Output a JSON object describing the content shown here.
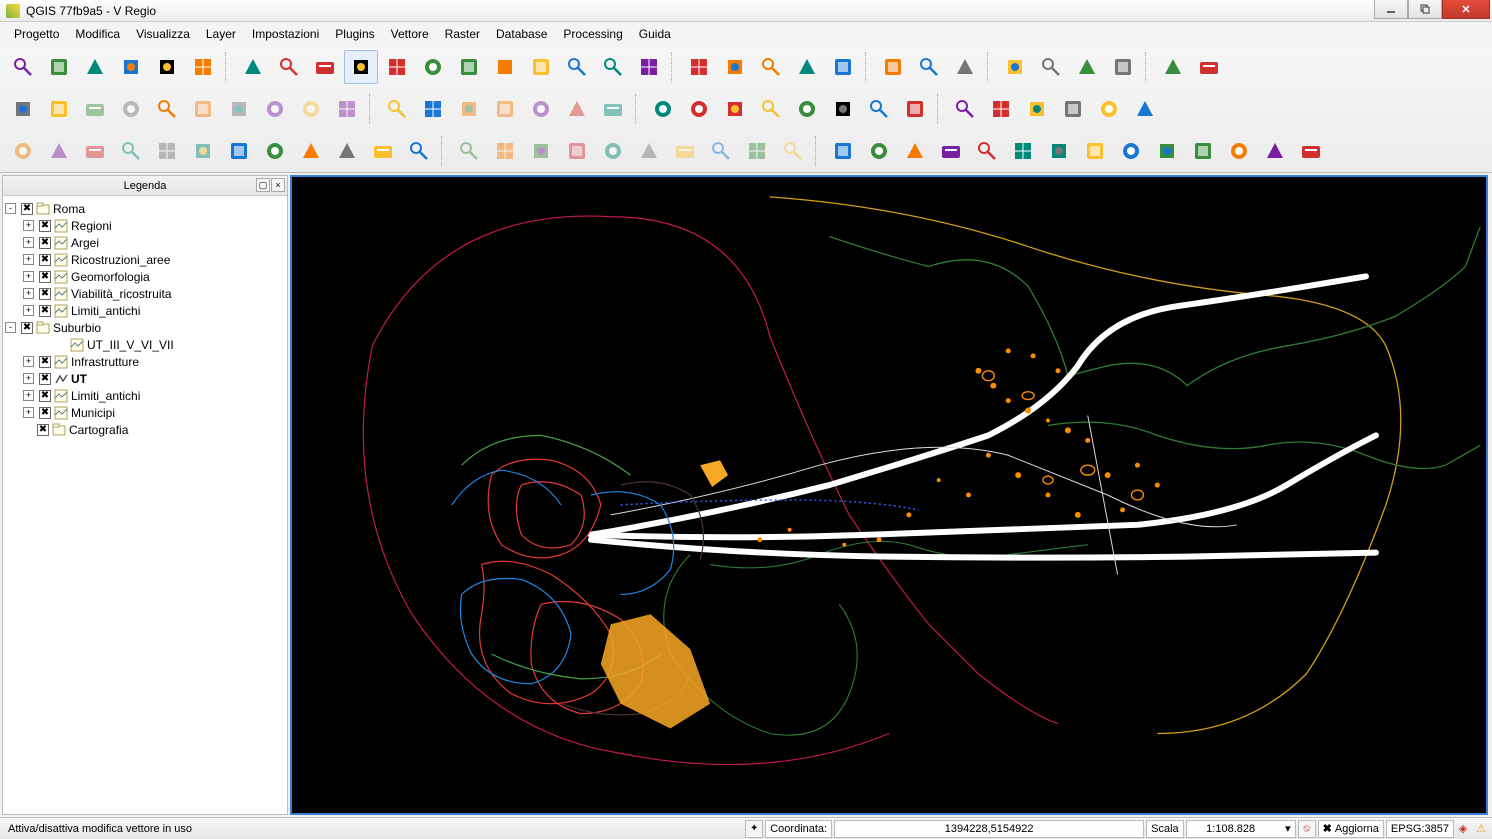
{
  "app_title": "QGIS 77fb9a5 - V Regio",
  "menu": [
    "Progetto",
    "Modifica",
    "Visualizza",
    "Layer",
    "Impostazioni",
    "Plugins",
    "Vettore",
    "Raster",
    "Database",
    "Processing",
    "Guida"
  ],
  "legend_panel": {
    "title": "Legenda",
    "tree": [
      {
        "exp": "-",
        "chk": "x",
        "icon": "group",
        "label": "Roma",
        "indent": 0
      },
      {
        "exp": "+",
        "chk": "x",
        "icon": "layer",
        "label": "Regioni",
        "indent": 1
      },
      {
        "exp": "+",
        "chk": "x",
        "icon": "layer",
        "label": "Argei",
        "indent": 1
      },
      {
        "exp": "+",
        "chk": "x",
        "icon": "layer",
        "label": "Ricostruzioni_aree",
        "indent": 1
      },
      {
        "exp": "+",
        "chk": "x",
        "icon": "layer",
        "label": "Geomorfologia",
        "indent": 1
      },
      {
        "exp": "+",
        "chk": "x",
        "icon": "layer",
        "label": "Viabilità_ricostruita",
        "indent": 1
      },
      {
        "exp": "+",
        "chk": "x",
        "icon": "layer",
        "label": "Limiti_antichi",
        "indent": 1
      },
      {
        "exp": "-",
        "chk": "x",
        "icon": "group",
        "label": "Suburbio",
        "indent": 0
      },
      {
        "exp": "",
        "chk": "",
        "icon": "layer",
        "label": "UT_III_V_VI_VII",
        "indent": 2
      },
      {
        "exp": "+",
        "chk": "x",
        "icon": "layer",
        "label": "Infrastrutture",
        "indent": 1
      },
      {
        "exp": "+",
        "chk": "x",
        "icon": "line",
        "label": "UT",
        "indent": 1,
        "bold": true
      },
      {
        "exp": "+",
        "chk": "x",
        "icon": "layer",
        "label": "Limiti_antichi",
        "indent": 1
      },
      {
        "exp": "+",
        "chk": "x",
        "icon": "layer",
        "label": "Municipi",
        "indent": 1
      },
      {
        "exp": "",
        "chk": "x",
        "icon": "group",
        "label": "Cartografia",
        "indent": 1
      }
    ]
  },
  "status": {
    "message": "Attiva/disattiva modifica vettore in uso",
    "coord_label": "Coordinata:",
    "coord_value": "1394228,5154922",
    "scale_label": "Scala",
    "scale_value": "1:108.828",
    "refresh_label": "Aggiorna",
    "epsg": "EPSG:3857"
  },
  "toolbar_icons_row1": [
    "new-doc",
    "open-folder",
    "save",
    "save-as",
    "new-layout",
    "layout-manager",
    "",
    "pan",
    "pan-select",
    "zoom-extent",
    "zoom-in",
    "zoom-out",
    "zoom-native",
    "zoom-full",
    "zoom-selection",
    "zoom-layer",
    "zoom-last",
    "zoom-next",
    "refresh",
    "",
    "identify",
    "info-dropdown",
    "select-dropdown",
    "deselect",
    "expression",
    "",
    "attr-table",
    "field-calc",
    "measure",
    "",
    "tips",
    "bookmark",
    "bookmark-new",
    "text-annot",
    "",
    "help",
    "whats-this"
  ],
  "toolbar_icons_row2": [
    "edit-pencil",
    "edit-line",
    "save-edits",
    "edit-nodes",
    "snap",
    "cut",
    "copy",
    "paste",
    "paste-features",
    "delete",
    "",
    "abc1",
    "abc2",
    "abc3",
    "abc4",
    "abc5",
    "abc6",
    "abc7",
    "",
    "wms",
    "wfs",
    "wcs",
    "csw",
    "postgis",
    "spatialite",
    "mssql",
    "oracledb",
    "",
    "v1",
    "v2",
    "v3",
    "v4",
    "v5",
    "v6"
  ],
  "toolbar_icons_row3": [
    "g1",
    "g2",
    "g3",
    "g4",
    "g5",
    "g6",
    "g7",
    "g8",
    "g9",
    "g10",
    "g11",
    "g12",
    "",
    "h1",
    "h2",
    "h3",
    "h4",
    "h5",
    "h6",
    "h7",
    "h8",
    "h9",
    "h10",
    "",
    "i1",
    "i2",
    "i3",
    "i4",
    "i5",
    "i6",
    "i7",
    "i8",
    "i9",
    "i10",
    "i11",
    "i12",
    "i13",
    "i14"
  ]
}
